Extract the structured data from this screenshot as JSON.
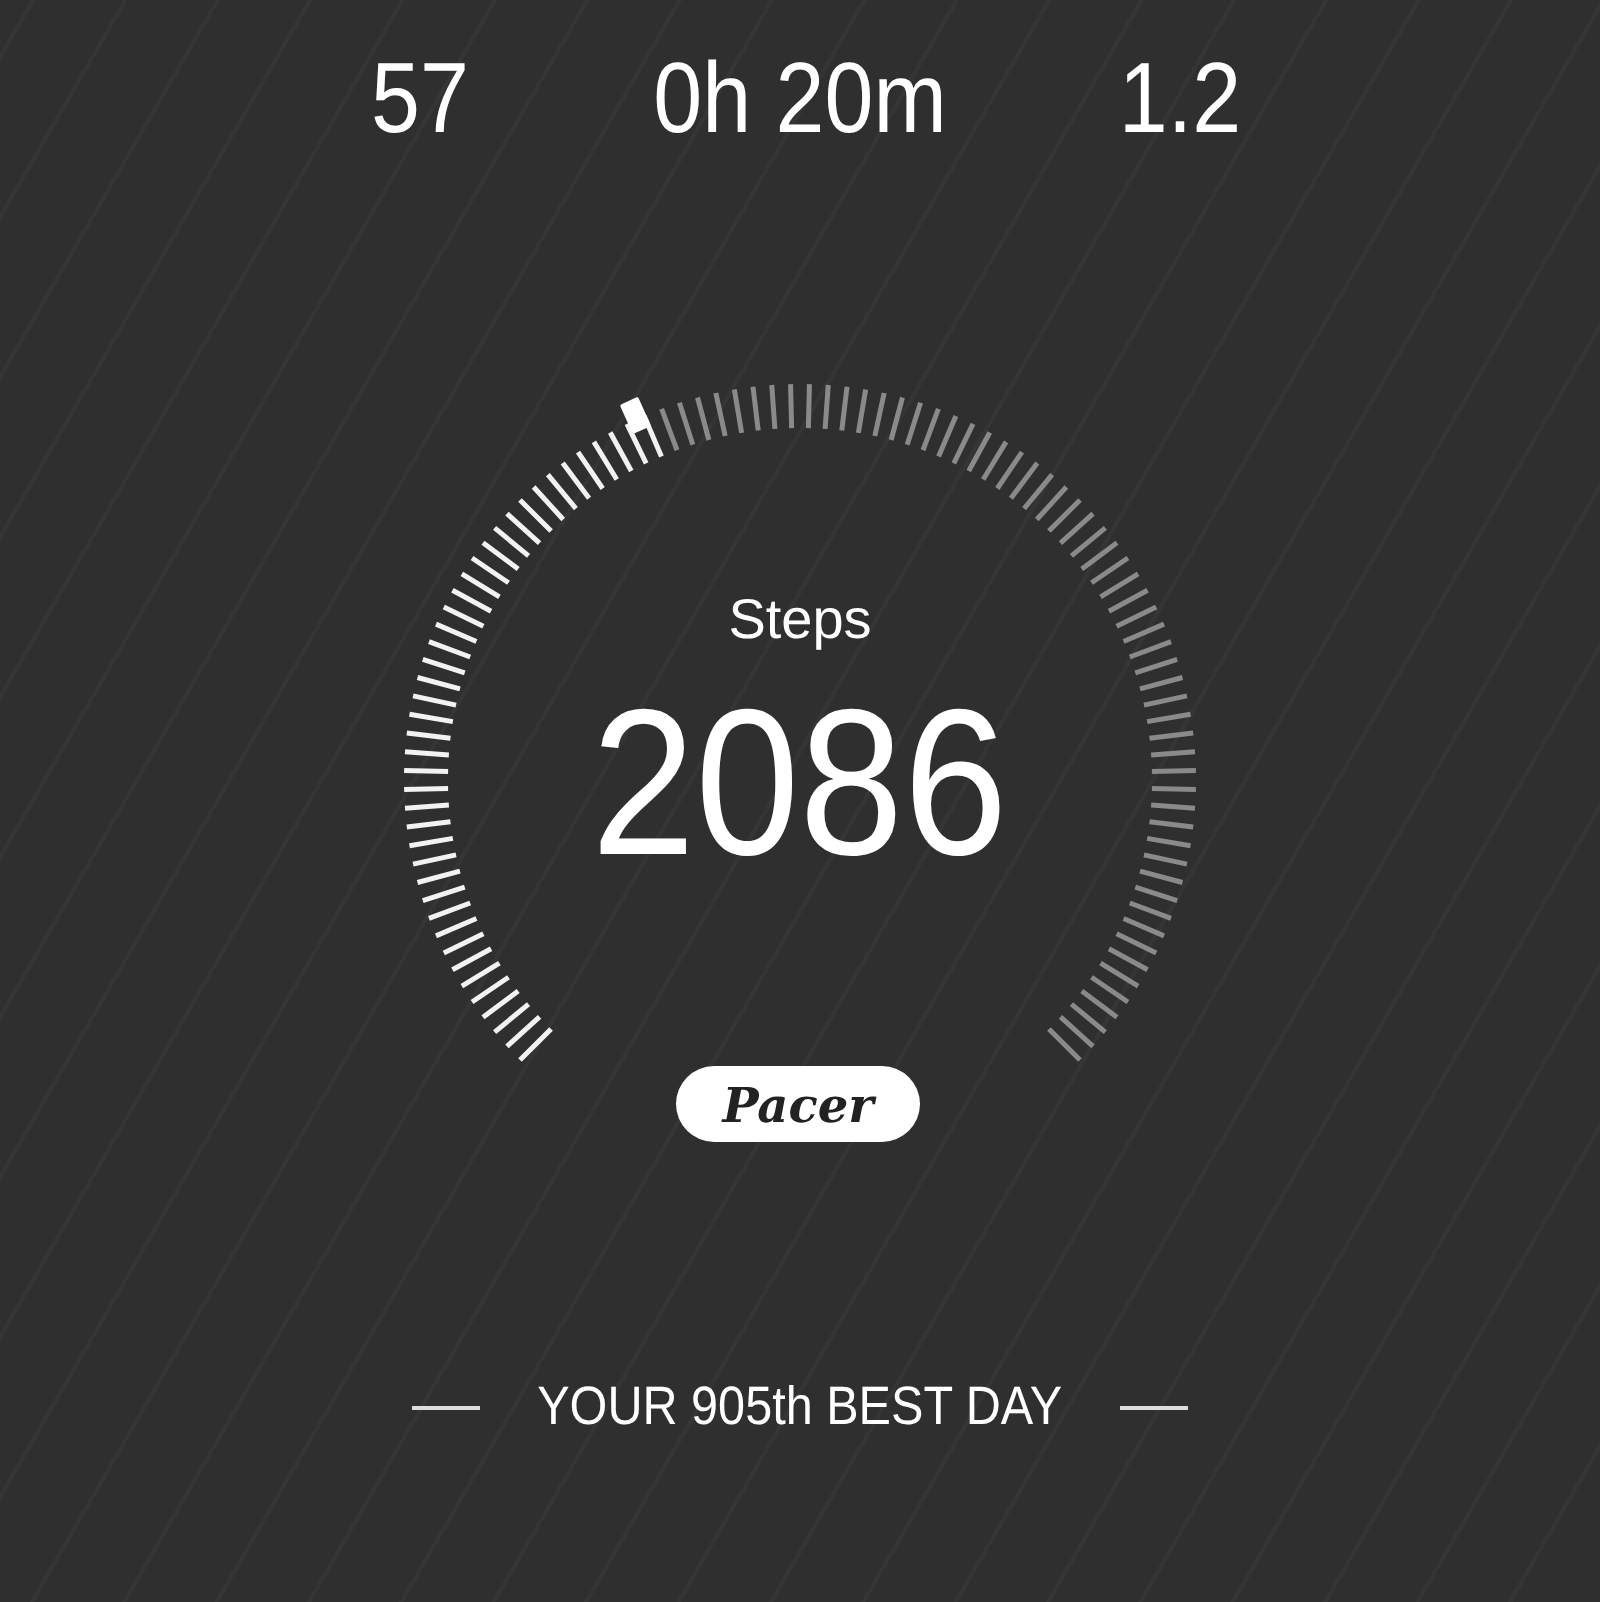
{
  "stats": [
    {
      "value": "57"
    },
    {
      "value": "0h 20m"
    },
    {
      "value": "1.2"
    }
  ],
  "gauge": {
    "label": "Steps",
    "value": "2086"
  },
  "logo": "Pacer",
  "footer": "YOUR 905th BEST DAY"
}
